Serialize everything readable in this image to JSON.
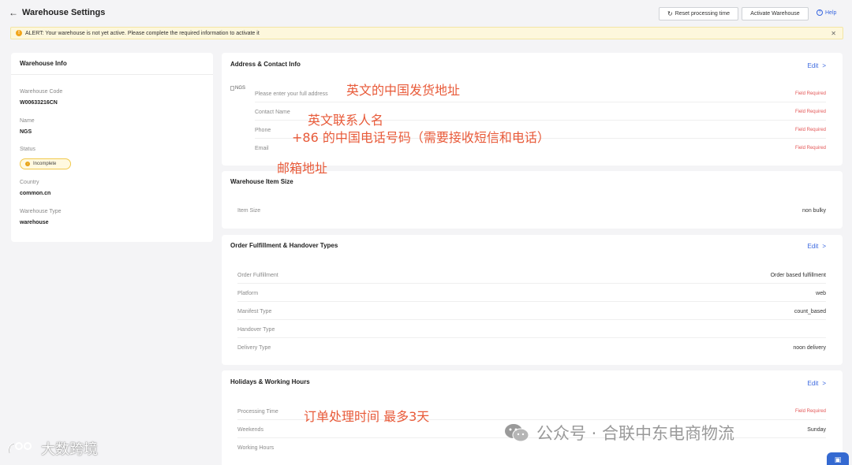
{
  "header": {
    "title": "Warehouse Settings",
    "reset_button": "Reset processing time",
    "activate_button": "Activate Warehouse",
    "help": "Help"
  },
  "alert": {
    "text": "ALERT: Your warehouse is not yet active. Please complete the required information to activate it"
  },
  "warehouse_info": {
    "title": "Warehouse Info",
    "code_label": "Warehouse Code",
    "code_value": "W00633216CN",
    "name_label": "Name",
    "name_value": "NGS",
    "status_label": "Status",
    "status_value": "Incomplete",
    "country_label": "Country",
    "country_value": "common.cn",
    "type_label": "Warehouse Type",
    "type_value": "warehouse"
  },
  "address_contact": {
    "title": "Address & Contact Info",
    "edit": "Edit",
    "image_alt": "NGS",
    "rows": [
      {
        "label": "Please enter your full address",
        "status": "Field Required"
      },
      {
        "label": "Contact Name",
        "status": "Field Required"
      },
      {
        "label": "Phone",
        "status": "Field Required"
      },
      {
        "label": "Email",
        "status": "Field Required"
      }
    ]
  },
  "item_size": {
    "title": "Warehouse Item Size",
    "rows": [
      {
        "label": "Item Size",
        "value": "non bulky"
      }
    ]
  },
  "fulfillment": {
    "title": "Order Fulfillment & Handover Types",
    "edit": "Edit",
    "rows": [
      {
        "label": "Order Fulfillment",
        "value": "Order based fulfillment"
      },
      {
        "label": "Platform",
        "value": "web"
      },
      {
        "label": "Manifest Type",
        "value": "count_based"
      },
      {
        "label": "Handover Type",
        "value": ""
      },
      {
        "label": "Delivery Type",
        "value": "noon delivery"
      }
    ]
  },
  "holidays": {
    "title": "Holidays & Working Hours",
    "edit": "Edit",
    "rows": [
      {
        "label": "Processing Time",
        "value": "Field Required"
      },
      {
        "label": "Weekends",
        "value": "Sunday"
      },
      {
        "label": "Working Hours",
        "value": ""
      }
    ]
  },
  "annotations": {
    "address": "英文的中国发货地址",
    "contact": "英文联系人名",
    "phone": "+86 的中国电话号码（需要接收短信和电话）",
    "email": "邮箱地址",
    "processing": "订单处理时间 最多3天"
  },
  "watermarks": {
    "left": "大数跨境",
    "right": "公众号 · 合联中东电商物流"
  },
  "colors": {
    "accent": "#3866df",
    "required": "#e35757",
    "annotation": "#e85a39",
    "alert_bg": "#fdf7dc",
    "badge_border": "#f1c94c"
  },
  "icons": {
    "back": "back-arrow-icon",
    "reset": "refresh-icon",
    "help": "help-circle-icon",
    "alert": "warning-icon",
    "close": "close-icon",
    "edit": "chevron-right-icon",
    "chat": "chat-icon"
  }
}
